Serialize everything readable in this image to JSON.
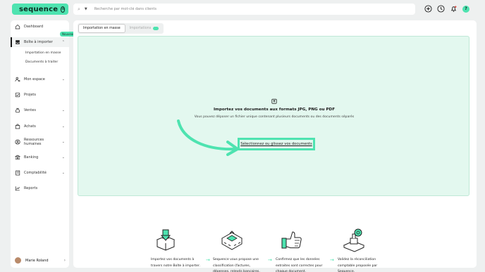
{
  "brand": {
    "name": "sequence",
    "accent": "#4ee3b0"
  },
  "search": {
    "placeholder": "Recherche par mot-clé dans clients"
  },
  "top_actions": {
    "help_label": "?"
  },
  "sidebar": {
    "items": [
      {
        "label": "Dashboard",
        "icon": "home-icon"
      },
      {
        "label": "Boîte à importer",
        "icon": "inbox-icon",
        "active": true,
        "badge": "Nouveau"
      },
      {
        "label": "Mon espace",
        "icon": "user-cog-icon"
      },
      {
        "label": "Projets",
        "icon": "checkbox-icon"
      },
      {
        "label": "Ventes",
        "icon": "money-bag-icon"
      },
      {
        "label": "Achats",
        "icon": "shopping-bag-icon"
      },
      {
        "label": "Ressources humaines",
        "icon": "people-icon"
      },
      {
        "label": "Banking",
        "icon": "bank-icon"
      },
      {
        "label": "Comptabilité",
        "icon": "ledger-icon"
      },
      {
        "label": "Reports",
        "icon": "chart-icon"
      }
    ],
    "sub_items": [
      "Importation en masse",
      "Documents à traiter"
    ],
    "user": {
      "name": "Marie Roland"
    }
  },
  "main": {
    "tabs": [
      {
        "label": "Importation en masse",
        "active": true
      },
      {
        "label": "Importations",
        "active": false
      }
    ],
    "dropzone": {
      "title": "Importez vos documents aux formats JPG, PNG ou PDF",
      "subtitle": "Vous pouvez déposer un fichier unique contenant plusieurs documents ou des documents séparés",
      "button": "Sélectionnez ou glissez vos documents"
    },
    "steps": [
      {
        "text": "Importez vos documents à travers notre Boîte à importer.",
        "illustration": "upload-box-illustration"
      },
      {
        "text": "Sequence vous propose une classification (factures, dépenses, relevés bancaires, politiques salariales)",
        "illustration": "sorting-machine-illustration"
      },
      {
        "text": "Confirmez que les données extraites sont correctes pour chaque document.",
        "illustration": "thumbs-up-illustration"
      },
      {
        "text": "Validez la réconciliation comptable proposée par Sequence.",
        "illustration": "stamp-illustration"
      }
    ],
    "step_arrow": "→"
  }
}
